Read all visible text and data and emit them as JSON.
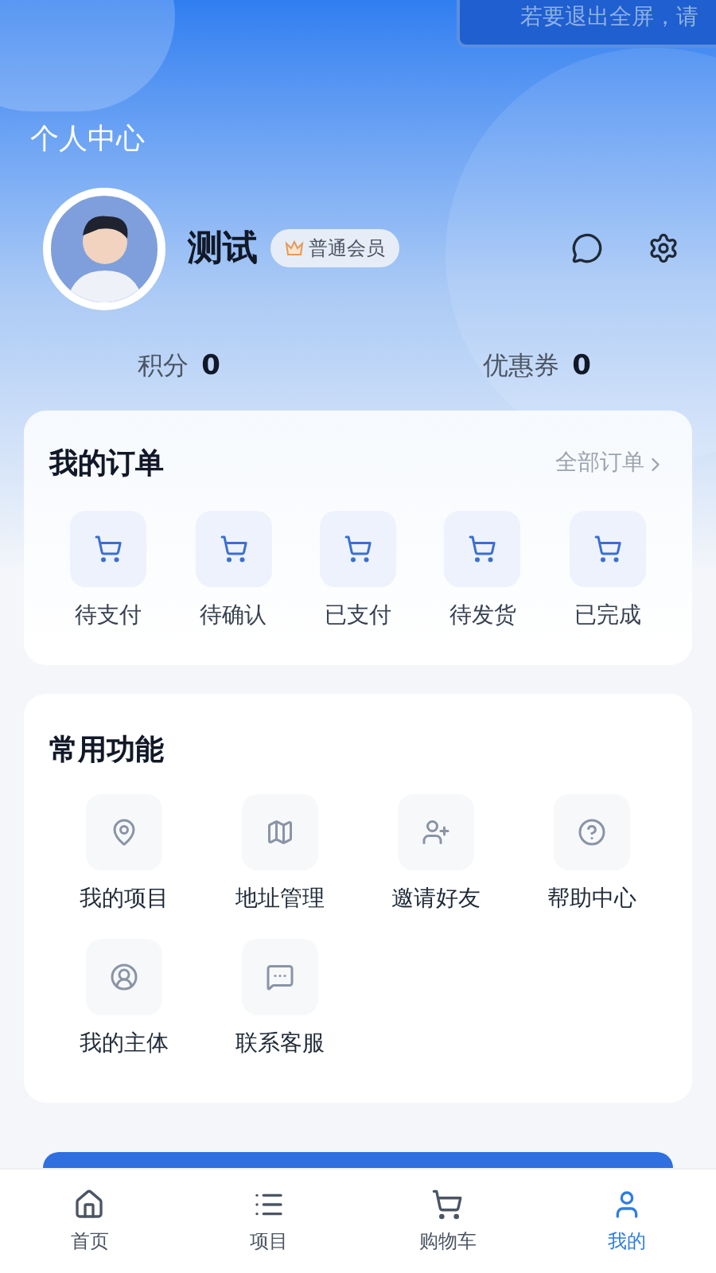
{
  "toast": {
    "text": "若要退出全屏，请"
  },
  "page_title": "个人中心",
  "profile": {
    "name": "测试",
    "badge": "普通会员"
  },
  "stats": [
    {
      "label": "积分",
      "value": "0"
    },
    {
      "label": "优惠券",
      "value": "0"
    }
  ],
  "orders": {
    "title": "我的订单",
    "all_link": "全部订单",
    "items": [
      "待支付",
      "待确认",
      "已支付",
      "待发货",
      "已完成"
    ]
  },
  "functions": {
    "title": "常用功能",
    "items": [
      "我的项目",
      "地址管理",
      "邀请好友",
      "帮助中心",
      "我的主体",
      "联系客服"
    ]
  },
  "tabs": [
    {
      "label": "首页",
      "selected": false
    },
    {
      "label": "项目",
      "selected": false
    },
    {
      "label": "购物车",
      "selected": false
    },
    {
      "label": "我的",
      "selected": true
    }
  ]
}
